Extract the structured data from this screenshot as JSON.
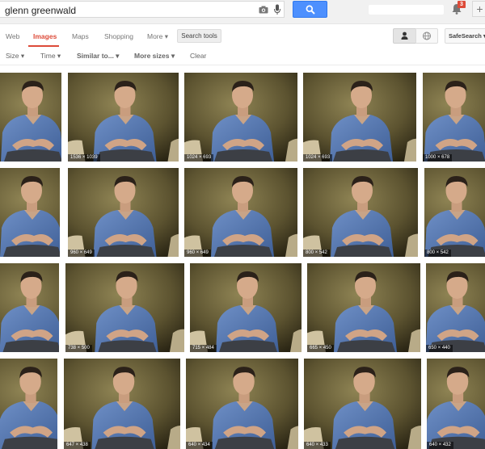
{
  "search": {
    "query": "glenn greenwald"
  },
  "notifications": {
    "count": "3"
  },
  "nav": {
    "web": "Web",
    "images": "Images",
    "maps": "Maps",
    "shopping": "Shopping",
    "more": "More ▾",
    "search_tools": "Search tools",
    "safesearch": "SafeSearch ▾"
  },
  "tools": {
    "size": "Size ▾",
    "time": "Time ▾",
    "similar": "Similar to... ▾",
    "more_sizes": "More sizes ▾",
    "clear": "Clear"
  },
  "colors": {
    "accent": "#dd4b39",
    "search_button": "#4d90fe"
  },
  "results": {
    "row1": [
      "",
      "1536 × 1039",
      "1024 × 693",
      "1024 × 693",
      "1000 × 678"
    ],
    "row2": [
      "",
      "960 × 649",
      "960 × 649",
      "800 × 542",
      "800 × 542"
    ],
    "row3": [
      "",
      "738 × 500",
      "715 × 484",
      "665 × 450",
      "650 × 440"
    ],
    "row4": [
      "",
      "647 × 438",
      "640 × 434",
      "640 × 433",
      "640 × 432"
    ]
  }
}
